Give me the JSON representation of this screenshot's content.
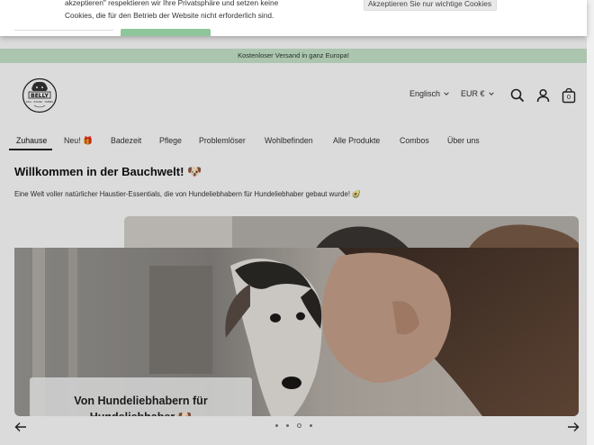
{
  "cookie": {
    "text_line1": "akzeptieren\" respektieren wir Ihre Privatsphäre und setzen keine",
    "text_line2": "Cookies, die für den Betrieb der Website nicht erforderlich sind.",
    "accept_essential_label": "Akzeptieren Sie nur wichtige Cookies"
  },
  "announcement": {
    "text": "Kostenloser Versand in ganz Europa!"
  },
  "header": {
    "logo_text": "BELLY",
    "logo_subtext": "DOG · HOUND · FRIEND",
    "language": "Englisch",
    "currency": "EUR €",
    "cart_count": "0",
    "icons": [
      "search-icon",
      "account-icon",
      "cart-icon",
      "chevron-down-icon"
    ]
  },
  "nav": {
    "items": [
      {
        "label": "Zuhause"
      },
      {
        "label": "Neu! 🎁"
      },
      {
        "label": "Badezeit"
      },
      {
        "label": "Pflege"
      },
      {
        "label": "Problemlöser"
      },
      {
        "label": "Wohlbefinden"
      },
      {
        "label": "Alle Produkte"
      },
      {
        "label": "Combos"
      },
      {
        "label": "Über uns"
      }
    ],
    "active": "Zuhause"
  },
  "welcome": {
    "title": "Willkommen in der Bauchwelt! 🐶",
    "subtitle": "Eine Welt voller natürlicher Haustier-Essentials, die von Hundeliebhabern für Hundeliebhaber gebaut wurde! 🥑"
  },
  "hero": {
    "card_text": "Von Hundeliebhabern für Hundeliebhaber 🐶",
    "slide_count": 4,
    "active_slide": 3
  },
  "colors": {
    "announcement_bg": "#c8e6cc",
    "accept_button_green": "#8fc59a"
  }
}
